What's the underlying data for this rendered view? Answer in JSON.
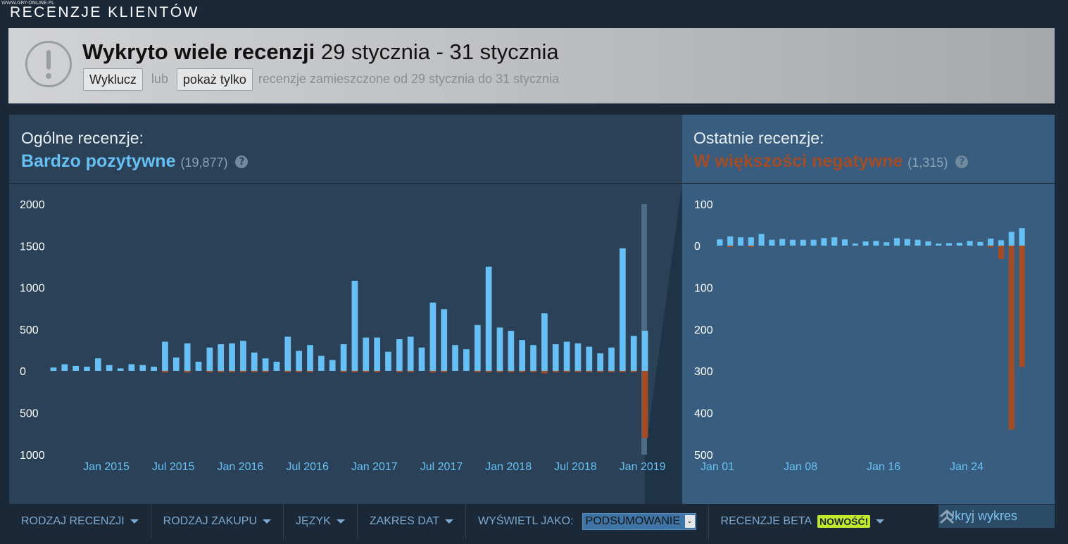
{
  "watermark": "WWW.GRY-ONLINE.PL",
  "section_title": "RECENZJE KLIENTÓW",
  "alert": {
    "icon": "exclamation-circle-icon",
    "title_bold": "Wykryto wiele recenzji",
    "title_dates": "29 stycznia - 31 stycznia",
    "exclude_label": "Wyklucz",
    "or_label": "lub",
    "show_only_label": "pokaż tylko",
    "description": "recenzje zamieszczone od 29 stycznia do 31 stycznia"
  },
  "overall": {
    "label": "Ogólne recenzje:",
    "rating": "Bardzo pozytywne",
    "count": "(19,877)",
    "rating_color": "#66c0f4",
    "help": "?"
  },
  "recent": {
    "label": "Ostatnie recenzje:",
    "rating": "W większości negatywne",
    "count": "(1,315)",
    "rating_color": "#a34c25",
    "help": "?"
  },
  "colors": {
    "positive": "#66c0f4",
    "negative": "#a34c25",
    "tick_text": "#ffffff",
    "date_text": "#66c0f4"
  },
  "chart_data": [
    {
      "type": "bar",
      "name": "overall-histogram",
      "y_ticks_positive": [
        "2000",
        "1500",
        "1000",
        "500",
        "0"
      ],
      "y_ticks_negative": [
        "500",
        "1000"
      ],
      "x_tick_labels": [
        "Jan 2015",
        "Jul 2015",
        "Jan 2016",
        "Jul 2016",
        "Jan 2017",
        "Jul 2017",
        "Jan 2018",
        "Jul 2018",
        "Jan 2019"
      ],
      "ylim_positive": [
        0,
        2000
      ],
      "ylim_negative": [
        0,
        1000
      ],
      "positive": [
        40,
        80,
        60,
        50,
        150,
        70,
        30,
        80,
        70,
        50,
        350,
        160,
        330,
        110,
        280,
        320,
        330,
        360,
        220,
        150,
        110,
        410,
        240,
        310,
        180,
        130,
        320,
        1080,
        400,
        400,
        230,
        380,
        410,
        280,
        820,
        740,
        310,
        260,
        550,
        1250,
        520,
        480,
        370,
        310,
        690,
        320,
        350,
        330,
        290,
        210,
        280,
        1470,
        420,
        480
      ],
      "negative": [
        0,
        0,
        0,
        0,
        0,
        0,
        0,
        0,
        0,
        0,
        20,
        0,
        20,
        0,
        5,
        10,
        5,
        10,
        5,
        5,
        0,
        15,
        5,
        5,
        0,
        0,
        5,
        10,
        5,
        5,
        0,
        5,
        5,
        0,
        20,
        10,
        0,
        0,
        15,
        10,
        5,
        10,
        10,
        5,
        30,
        5,
        5,
        5,
        5,
        5,
        10,
        10,
        5,
        800
      ]
    },
    {
      "type": "bar",
      "name": "recent-histogram",
      "y_ticks_positive": [
        "100",
        "0"
      ],
      "y_ticks_negative": [
        "100",
        "200",
        "300",
        "400",
        "500"
      ],
      "x_tick_labels": [
        "Jan 01",
        "Jan 08",
        "Jan 16",
        "Jan 24"
      ],
      "ylim_positive": [
        0,
        100
      ],
      "ylim_negative": [
        0,
        500
      ],
      "positive": [
        15,
        22,
        20,
        20,
        28,
        14,
        16,
        14,
        14,
        14,
        18,
        20,
        15,
        5,
        10,
        11,
        8,
        18,
        16,
        14,
        10,
        5,
        6,
        7,
        11,
        9,
        17,
        13,
        33,
        42
      ],
      "negative": [
        0,
        3,
        0,
        3,
        0,
        0,
        0,
        0,
        0,
        0,
        0,
        0,
        0,
        0,
        0,
        0,
        0,
        0,
        0,
        0,
        0,
        0,
        0,
        0,
        0,
        0,
        4,
        32,
        440,
        290
      ]
    }
  ],
  "filters": {
    "review_type": "RODZAJ RECENZJI",
    "purchase_type": "RODZAJ ZAKUPU",
    "language": "JĘZYK",
    "date_range": "ZAKRES DAT",
    "display_as": "WYŚWIETL JAKO:",
    "display_value": "PODSUMOWANIE",
    "beta_reviews": "RECENZJE BETA",
    "new_badge": "NOWOŚĆ!"
  },
  "hide_graph": "Ukryj wykres"
}
